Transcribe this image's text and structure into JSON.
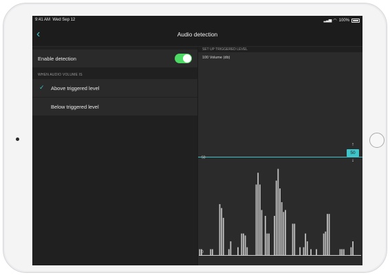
{
  "status": {
    "time": "9:41 AM",
    "date": "Wed Sep 12",
    "battery": "100%"
  },
  "nav": {
    "title": "Audio detection"
  },
  "settings": {
    "enable_label": "Enable detection",
    "enable_on": true,
    "section_label": "WHEN AUDIO VOLUME IS",
    "options": [
      {
        "label": "Above triggered level",
        "selected": true
      },
      {
        "label": "Below triggered level",
        "selected": false
      }
    ]
  },
  "panel": {
    "header": "SET UP TRIGGERED LEVEL",
    "axis_label": "100 Volume (db)",
    "level_label": "50",
    "zero_label": "0",
    "badge_value": "50"
  },
  "colors": {
    "accent": "#3fc4c9",
    "toggle_on": "#4cd964",
    "bars": "#bdbdbd"
  },
  "meter": {
    "max": 100,
    "level": 50,
    "values": [
      3,
      3,
      0,
      0,
      0,
      0,
      3,
      3,
      0,
      0,
      0,
      26,
      24,
      19,
      0,
      0,
      3,
      7,
      0,
      0,
      0,
      4,
      0,
      11,
      11,
      10,
      4,
      0,
      0,
      0,
      0,
      36,
      42,
      36,
      23,
      0,
      20,
      11,
      11,
      0,
      0,
      20,
      38,
      44,
      34,
      27,
      22,
      23,
      0,
      0,
      0,
      16,
      16,
      0,
      0,
      4,
      0,
      4,
      11,
      7,
      0,
      3,
      0,
      0,
      3,
      0,
      0,
      0,
      11,
      12,
      21,
      21,
      0,
      0,
      0,
      0,
      0,
      3,
      3,
      3,
      0,
      0,
      0,
      4,
      7,
      0,
      0,
      0,
      0
    ]
  }
}
